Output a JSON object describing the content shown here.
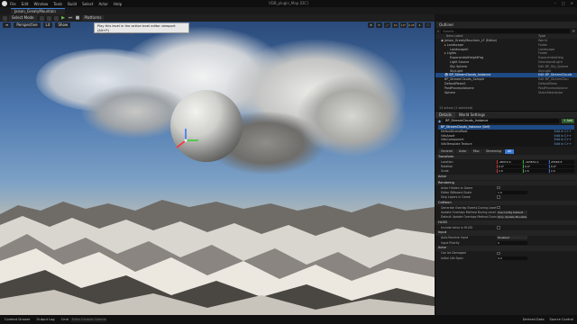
{
  "menubar": {
    "items": [
      "File",
      "Edit",
      "Window",
      "Tools",
      "Build",
      "Select",
      "Actor",
      "Help"
    ],
    "window_title": "VDB_plugin_Map [DC]"
  },
  "tabs": {
    "level_tab": "Jaison_GreatyMountain"
  },
  "toolbar": {
    "select_mode": "Select Mode",
    "platforms": "Platforms"
  },
  "tooltip": {
    "line1": "Play this level in the active level editor viewport (Alt+P)",
    "line2": "Hold Ctrl + Alt to view"
  },
  "viewport": {
    "perspective": "Perspective",
    "lit": "Lit",
    "show": "Show",
    "right_buttons": [
      "10",
      "10°",
      "0.25",
      "4"
    ]
  },
  "outliner": {
    "tab": "Outliner",
    "search_placeholder": "Search...",
    "col_label": "Item Label",
    "col_type": "Type",
    "rows": [
      {
        "label": "Jaison_GreatyMountain_LF (Editor)",
        "type": "World"
      },
      {
        "label": "Landscape",
        "type": "Folder"
      },
      {
        "label": "Landscape0",
        "type": "Landscape"
      },
      {
        "label": "Lights",
        "type": "Folder"
      },
      {
        "label": "ExponentialHeightFog",
        "type": "ExponentialHeig"
      },
      {
        "label": "Light Source",
        "type": "DirectionalLight"
      },
      {
        "label": "Sky Sphere",
        "type": "Edit BP_Sky_Sphere"
      },
      {
        "label": "SkyLight",
        "type": "SkyLight"
      },
      {
        "label": "BP_StreamClouds_Instance",
        "type": "Edit BP_StreamClouds"
      },
      {
        "label": "BP_StreamClouds_Sample",
        "type": "Edit BP_StreamClou"
      },
      {
        "label": "DefaultPawn0",
        "type": "DefaultPawn"
      },
      {
        "label": "PostProcessVolume",
        "type": "PostProcessVolume"
      },
      {
        "label": "Sphere",
        "type": "StaticMeshActor"
      }
    ],
    "selected_index": 8,
    "status": "13 actors (1 selected)"
  },
  "details": {
    "tab": "Details",
    "tab2": "World Settings",
    "actor_name": "BP_StreamClouds_Instance",
    "add_label": "+ Add",
    "components": [
      {
        "name": "BP_StreamClouds_Instance (Self)",
        "edit": ""
      },
      {
        "name": "DefaultSceneRoot",
        "edit": "Edit in C++"
      },
      {
        "name": "VdbAsset",
        "edit": "Edit in C++"
      },
      {
        "name": "VdbComponent",
        "edit": "Edit in C++"
      },
      {
        "name": "VdbTemplate Texture",
        "edit": "Edit in C++"
      }
    ],
    "filter_tabs": [
      "General",
      "Actor",
      "Misc",
      "Streaming",
      "All"
    ],
    "filter_active": 4,
    "sections": {
      "transform": "Transform",
      "actor": "Actor",
      "rendering": "Rendering",
      "collision": "Collision",
      "hlod": "HLOD",
      "input": "Input",
      "actor2": "Actor"
    },
    "transform": [
      {
        "label": "Location",
        "x": "-48372.0",
        "y": "-103651.0",
        "z": "25563.5"
      },
      {
        "label": "Rotation",
        "x": "0.0°",
        "y": "0.0°",
        "z": "0.0°"
      },
      {
        "label": "Scale",
        "x": "1.5",
        "y": "1.5",
        "z": "1.5"
      }
    ],
    "rendering": [
      {
        "label": "Actor Hidden In Game",
        "kind": "check"
      },
      {
        "label": "Editor Billboard Scale",
        "kind": "num",
        "value": "1.0"
      },
      {
        "label": "Skip Layers in Game",
        "kind": "check"
      }
    ],
    "collision": [
      {
        "label": "Generate Overlap Events During Level Streaming",
        "kind": "check"
      },
      {
        "label": "Update Overlaps Method During Level Streaming",
        "kind": "dd",
        "value": "Use Config Default"
      },
      {
        "label": "Default Update Overlaps Method During Level Streaming",
        "kind": "dd",
        "value": "Only Update Movable"
      }
    ],
    "hlod": [
      {
        "label": "Include Actor in HLOD",
        "kind": "check"
      }
    ],
    "input": [
      {
        "label": "Auto Receive Input",
        "kind": "dd",
        "value": "Disabled"
      },
      {
        "label": "Input Priority",
        "kind": "num",
        "value": "0"
      }
    ],
    "actor2": [
      {
        "label": "Can be Damaged",
        "kind": "check"
      },
      {
        "label": "Initial Life Span",
        "kind": "num",
        "value": "0.0"
      }
    ]
  },
  "statusbar": {
    "content_drawer": "Content Drawer",
    "output_log": "Output Log",
    "cmd": "Cmd",
    "console_placeholder": "Enter Console Command",
    "derived_data": "Derived Data",
    "source_control": "Source Control"
  }
}
